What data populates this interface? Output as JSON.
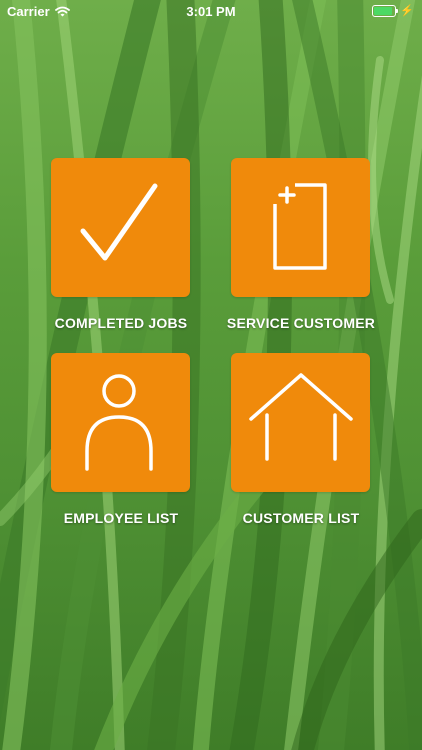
{
  "status_bar": {
    "carrier": "Carrier",
    "time": "3:01 PM",
    "battery_level": 0.9,
    "icons": [
      "wifi-icon",
      "battery-icon",
      "charging-bolt-icon"
    ]
  },
  "colors": {
    "tile": "#f08a0b",
    "label": "#ffffff",
    "background": "#5a9d3a"
  },
  "menu": {
    "items": [
      {
        "label": "COMPLETED JOBS",
        "icon": "checkmark-icon"
      },
      {
        "label": "SERVICE CUSTOMER",
        "icon": "clipboard-add-icon"
      },
      {
        "label": "EMPLOYEE LIST",
        "icon": "person-icon"
      },
      {
        "label": "CUSTOMER LIST",
        "icon": "house-icon"
      }
    ]
  }
}
